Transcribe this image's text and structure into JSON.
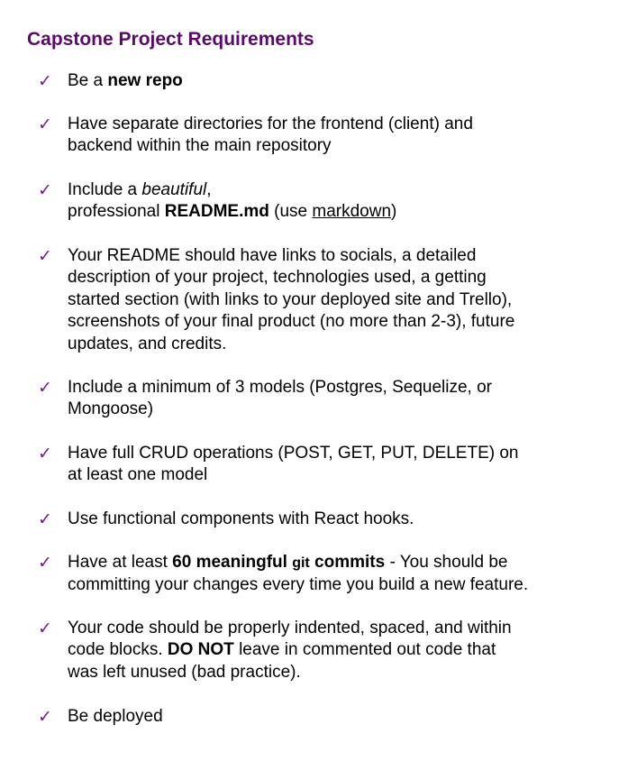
{
  "title": "Capstone Project Requirements",
  "items": [
    {
      "parts": [
        "Be a ",
        "new repo"
      ]
    },
    {
      "parts": [
        "Have separate directories for the frontend (client) and",
        "backend within the main repository"
      ]
    },
    {
      "parts": [
        "Include a ",
        "beautiful",
        ",",
        "professional ",
        "README.md",
        " (use ",
        "markdown",
        ")"
      ]
    },
    {
      "parts": [
        "Your README should have links to socials, a detailed",
        "description of your project, technologies used, a getting",
        "started section (with links to your deployed site and Trello),",
        "screenshots of your final product (no more than 2-3), future",
        "updates, and credits."
      ]
    },
    {
      "parts": [
        "Include a minimum of 3 models (Postgres, Sequelize, or",
        "Mongoose)"
      ]
    },
    {
      "parts": [
        "Have full CRUD operations (POST, GET, PUT, DELETE) on",
        "at least one model"
      ]
    },
    {
      "parts": [
        "Use functional components with React hooks."
      ]
    },
    {
      "parts": [
        "Have at least ",
        "60 meaningful ",
        "git",
        " commits",
        " - You should be",
        "committing your changes every time you build a new feature."
      ]
    },
    {
      "parts": [
        "Your code should be properly indented, spaced, and within",
        "code blocks. ",
        "DO NOT",
        " leave in commented out code that",
        "was left unused (bad practice)."
      ]
    },
    {
      "parts": [
        "Be deployed"
      ]
    }
  ],
  "check_glyph": "✓",
  "colors": {
    "title": "#5b0a6b",
    "check": "#7a1a8c"
  }
}
